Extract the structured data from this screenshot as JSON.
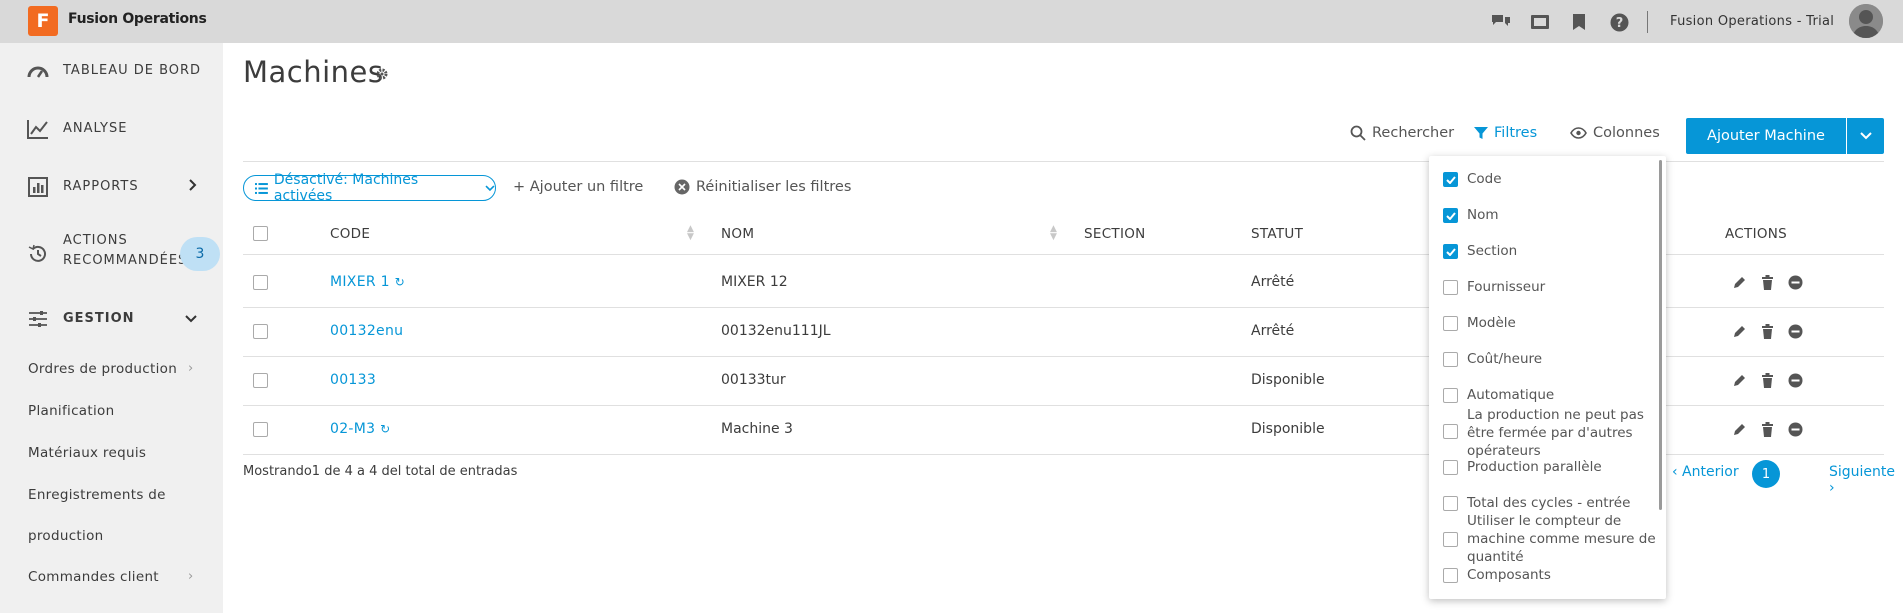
{
  "app": {
    "logo_letter": "F",
    "name": "Fusion Operations",
    "account": "Fusion Operations - Trial"
  },
  "topbar_icons": [
    "chat-icon",
    "video-icon",
    "bookmark-icon",
    "help-icon"
  ],
  "sidebar": {
    "items": [
      {
        "label": "TABLEAU DE BORD",
        "icon": "dashboard-icon"
      },
      {
        "label": "ANALYSE",
        "icon": "analytics-icon"
      },
      {
        "label": "RAPPORTS",
        "icon": "reports-icon"
      },
      {
        "label_line1": "ACTIONS",
        "label_line2": "RECOMMANDÉES",
        "icon": "history-icon",
        "badge": "3"
      },
      {
        "label": "GESTION",
        "icon": "sliders-icon"
      }
    ],
    "sub_items": [
      "Ordres de production",
      "Planification",
      "Matériaux requis",
      "Enregistrements de",
      "production",
      "Commandes client"
    ]
  },
  "page": {
    "title": "Machines"
  },
  "toolbar": {
    "search": "Rechercher",
    "filters": "Filtres",
    "columns": "Colonnes",
    "add_button": "Ajouter Machine"
  },
  "filters": {
    "chip": "Désactivé: Machines activées",
    "add_filter": "+ Ajouter un filtre",
    "reset": "Réinitialiser les filtres"
  },
  "table": {
    "headers": {
      "code": "CODE",
      "nom": "NOM",
      "section": "SECTION",
      "statut": "STATUT",
      "actions": "ACTIONS"
    },
    "rows": [
      {
        "code": "MIXER 1",
        "sync": true,
        "nom": "MIXER 12",
        "statut": "Arrêté"
      },
      {
        "code": "00132enu",
        "sync": false,
        "nom": "00132enu111JL",
        "statut": "Arrêté"
      },
      {
        "code": "00133",
        "sync": false,
        "nom": "00133tur",
        "statut": "Disponible"
      },
      {
        "code": "02-M3",
        "sync": true,
        "nom": "Machine 3",
        "statut": "Disponible"
      }
    ]
  },
  "footer": {
    "summary": "Mostrando1 de 4 a 4 del total de entradas",
    "prev": "‹ Anterior",
    "page": "1",
    "next": "Siguiente ›"
  },
  "column_menu": {
    "options": [
      {
        "label": "Code",
        "checked": true
      },
      {
        "label": "Nom",
        "checked": true
      },
      {
        "label": "Section",
        "checked": true
      },
      {
        "label": "Fournisseur",
        "checked": false
      },
      {
        "label": "Modèle",
        "checked": false
      },
      {
        "label": "Coût/heure",
        "checked": false
      },
      {
        "label": "Automatique",
        "checked": false
      },
      {
        "label_lines": [
          "La production ne peut pas",
          "être fermée par d'autres",
          "opérateurs"
        ],
        "checked": false
      },
      {
        "label": "Production parallèle",
        "checked": false
      },
      {
        "label": "Total des cycles - entrée",
        "checked": false
      },
      {
        "label_lines": [
          "Utiliser le compteur de",
          "machine comme mesure de",
          "quantité"
        ],
        "checked": false
      },
      {
        "label": "Composants",
        "checked": false
      }
    ]
  },
  "colors": {
    "accent": "#0696d7",
    "topbar": "#d9d9d9",
    "sidebar": "#f0f0f0",
    "logo": "#f26b21"
  }
}
